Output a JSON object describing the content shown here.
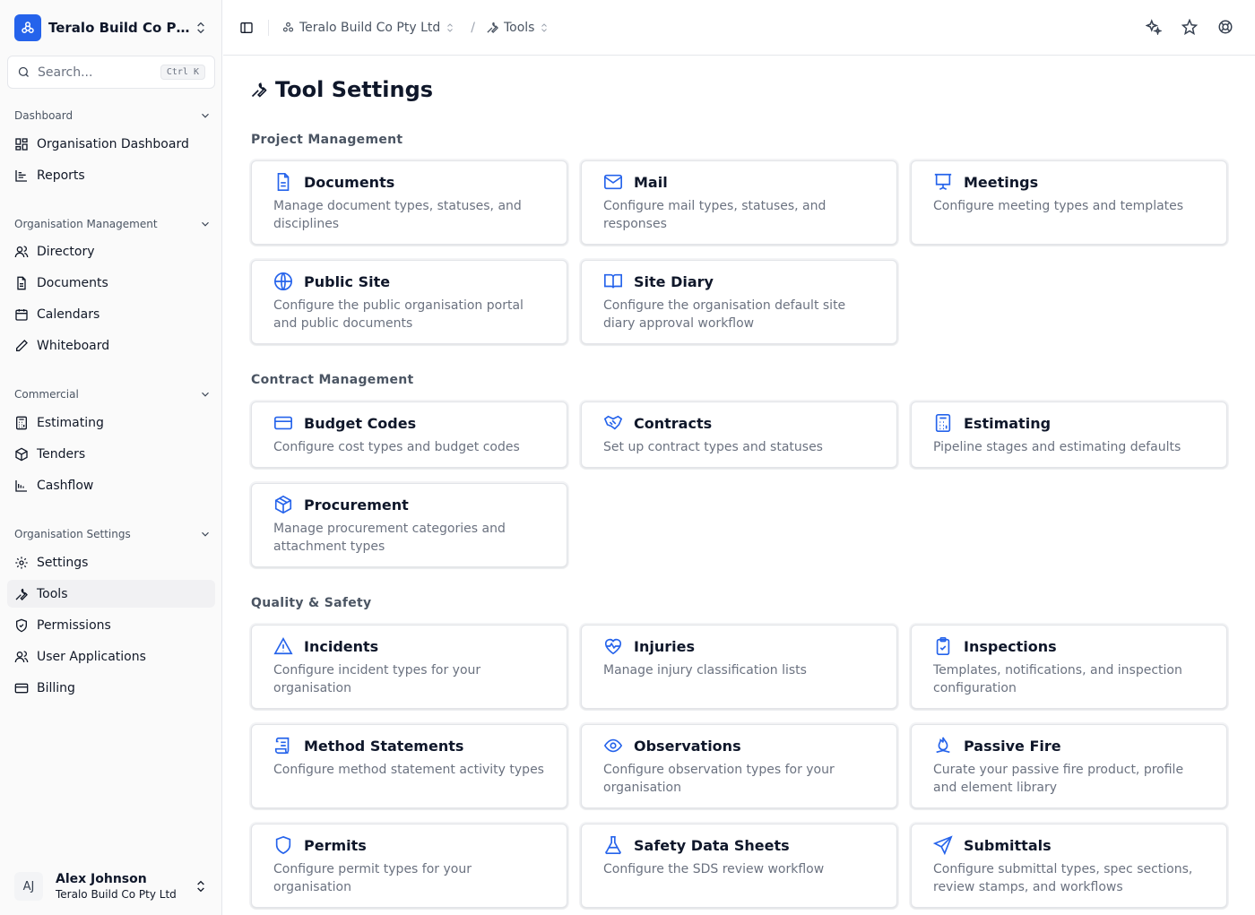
{
  "org": {
    "name": "Teralo Build Co Pty Ltd",
    "display_name": "Teralo Build Co Pt..."
  },
  "search": {
    "placeholder": "Search...",
    "shortcut": "Ctrl K"
  },
  "sidebar": {
    "groups": [
      {
        "label": "Dashboard",
        "items": [
          "Organisation Dashboard",
          "Reports"
        ]
      },
      {
        "label": "Organisation Management",
        "items": [
          "Directory",
          "Documents",
          "Calendars",
          "Whiteboard"
        ]
      },
      {
        "label": "Commercial",
        "items": [
          "Estimating",
          "Tenders",
          "Cashflow"
        ]
      },
      {
        "label": "Organisation Settings",
        "items": [
          "Settings",
          "Tools",
          "Permissions",
          "User Applications",
          "Billing"
        ]
      }
    ],
    "active_item": "Tools"
  },
  "user": {
    "initials": "AJ",
    "name": "Alex Johnson",
    "org": "Teralo Build Co Pty Ltd"
  },
  "breadcrumb": {
    "org": "Teralo Build Co Pty Ltd",
    "separator": "/",
    "page": "Tools"
  },
  "page": {
    "title": "Tool Settings"
  },
  "sections": [
    {
      "title": "Project Management",
      "cards": [
        {
          "icon": "document-icon",
          "title": "Documents",
          "desc": "Manage document types, statuses, and disciplines"
        },
        {
          "icon": "mail-icon",
          "title": "Mail",
          "desc": "Configure mail types, statuses, and responses"
        },
        {
          "icon": "presentation-icon",
          "title": "Meetings",
          "desc": "Configure meeting types and templates"
        },
        {
          "icon": "globe-icon",
          "title": "Public Site",
          "desc": "Configure the public organisation portal and public documents"
        },
        {
          "icon": "book-open-icon",
          "title": "Site Diary",
          "desc": "Configure the organisation default site diary approval workflow"
        }
      ]
    },
    {
      "title": "Contract Management",
      "cards": [
        {
          "icon": "credit-card-icon",
          "title": "Budget Codes",
          "desc": "Configure cost types and budget codes"
        },
        {
          "icon": "handshake-icon",
          "title": "Contracts",
          "desc": "Set up contract types and statuses"
        },
        {
          "icon": "calculator-icon",
          "title": "Estimating",
          "desc": "Pipeline stages and estimating defaults"
        },
        {
          "icon": "package-icon",
          "title": "Procurement",
          "desc": "Manage procurement categories and attachment types"
        }
      ]
    },
    {
      "title": "Quality & Safety",
      "cards": [
        {
          "icon": "warning-triangle-icon",
          "title": "Incidents",
          "desc": "Configure incident types for your organisation"
        },
        {
          "icon": "heart-pulse-icon",
          "title": "Injuries",
          "desc": "Manage injury classification lists"
        },
        {
          "icon": "clipboard-check-icon",
          "title": "Inspections",
          "desc": "Templates, notifications, and inspection configuration"
        },
        {
          "icon": "scroll-icon",
          "title": "Method Statements",
          "desc": "Configure method statement activity types"
        },
        {
          "icon": "eye-icon",
          "title": "Observations",
          "desc": "Configure observation types for your organisation"
        },
        {
          "icon": "flame-icon",
          "title": "Passive Fire",
          "desc": "Curate your passive fire product, profile and element library"
        },
        {
          "icon": "shield-icon",
          "title": "Permits",
          "desc": "Configure permit types for your organisation"
        },
        {
          "icon": "flask-icon",
          "title": "Safety Data Sheets",
          "desc": "Configure the SDS review workflow"
        },
        {
          "icon": "send-icon",
          "title": "Submittals",
          "desc": "Configure submittal types, spec sections, review stamps, and workflows"
        }
      ]
    }
  ],
  "colors": {
    "accent": "#2563eb",
    "text": "#0f172a",
    "muted": "#6b7280"
  }
}
